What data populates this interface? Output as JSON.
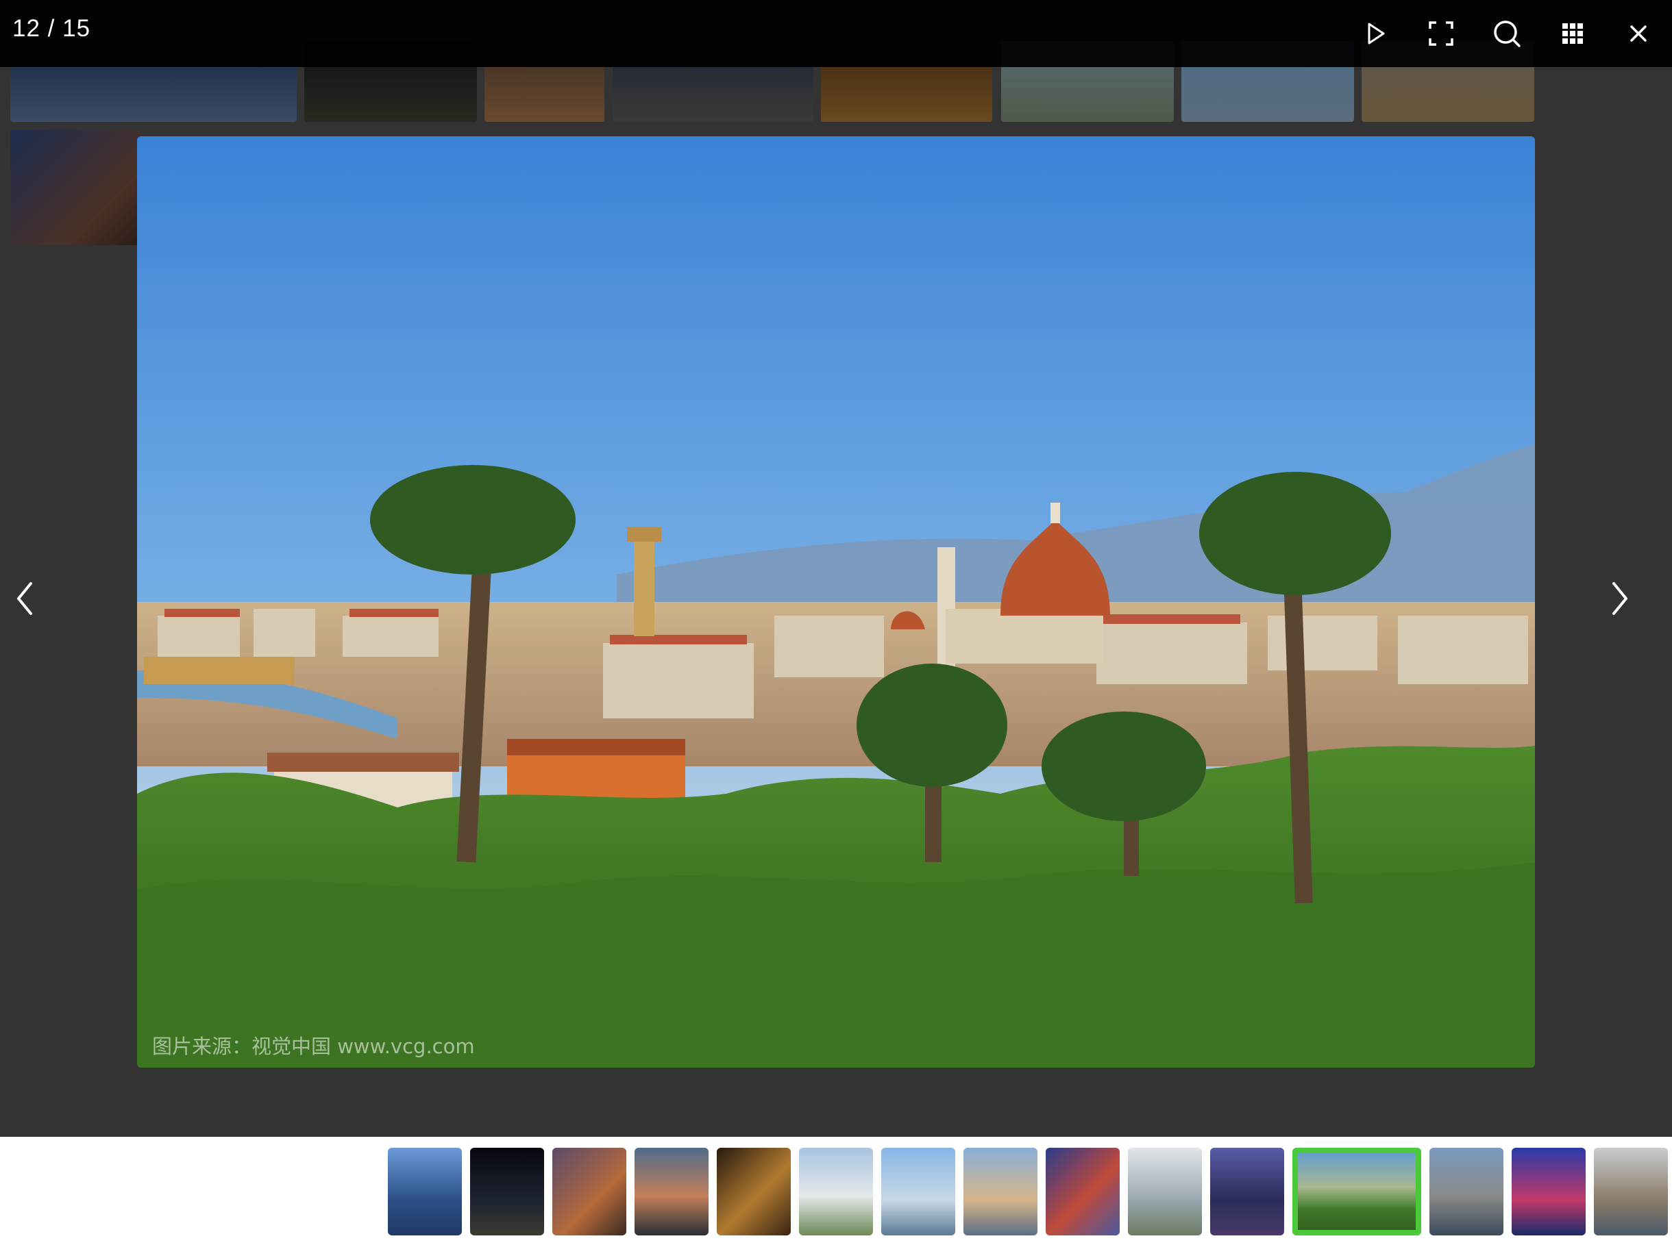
{
  "viewer": {
    "counter": "12 / 15",
    "current_index": 12,
    "total": 15
  },
  "toolbar": {
    "buttons": [
      {
        "name": "slideshow-play-button",
        "icon": "play-icon"
      },
      {
        "name": "fullscreen-button",
        "icon": "fullscreen-icon"
      },
      {
        "name": "zoom-button",
        "icon": "magnifier-icon"
      },
      {
        "name": "grid-view-button",
        "icon": "grid-icon"
      },
      {
        "name": "close-button",
        "icon": "close-icon"
      }
    ]
  },
  "main_image": {
    "subject": "Florence city skyline with cathedral dome, palm trees and hills",
    "watermark": "图片来源：视觉中国 www.vcg.com"
  },
  "navigation": {
    "prev_icon": "chevron-left-icon",
    "next_icon": "chevron-right-icon"
  },
  "filmstrip": {
    "active_index": 12,
    "thumbnails": [
      {
        "index": 1,
        "tone": "#3d6aa8"
      },
      {
        "index": 2,
        "tone": "#15171e"
      },
      {
        "index": 3,
        "tone": "#7a5740"
      },
      {
        "index": 4,
        "tone": "#4b5e70"
      },
      {
        "index": 5,
        "tone": "#5a3a22"
      },
      {
        "index": 6,
        "tone": "#b7c9dd"
      },
      {
        "index": 7,
        "tone": "#7fa9d6"
      },
      {
        "index": 8,
        "tone": "#9fb6cc"
      },
      {
        "index": 9,
        "tone": "#3e4f8d"
      },
      {
        "index": 10,
        "tone": "#c3ccd1"
      },
      {
        "index": 11,
        "tone": "#3d3f78"
      },
      {
        "index": 12,
        "tone": "#4d8a3a"
      },
      {
        "index": 13,
        "tone": "#5f7185"
      },
      {
        "index": 14,
        "tone": "#2c3f94"
      },
      {
        "index": 15,
        "tone": "#9a8e7e"
      }
    ]
  },
  "colors": {
    "active_thumb_border": "#4cc93a",
    "toolbar_bg": "#000000",
    "viewer_bg": "#333333"
  }
}
